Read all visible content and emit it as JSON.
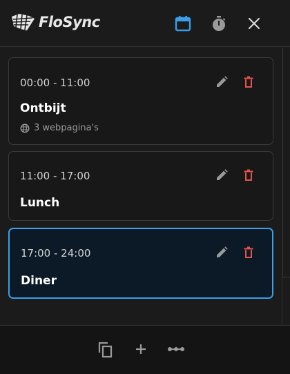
{
  "app": {
    "name": "FloSync",
    "colors": {
      "accent": "#3a9ee8",
      "danger": "#e5534b",
      "icon_muted": "#9a9a9a"
    }
  },
  "header": {
    "logo_icon": "flosync-logo-icon",
    "buttons": [
      {
        "icon": "calendar-icon",
        "active": true
      },
      {
        "icon": "stopwatch-icon",
        "active": false
      },
      {
        "icon": "close-icon",
        "active": false
      }
    ]
  },
  "schedule": {
    "items": [
      {
        "time": "00:00 - 11:00",
        "title": "Ontbijt",
        "meta": "3 webpagina's",
        "meta_icon": "globe-icon",
        "active": false
      },
      {
        "time": "11:00 - 17:00",
        "title": "Lunch",
        "active": false
      },
      {
        "time": "17:00 - 24:00",
        "title": "Diner",
        "active": true
      }
    ],
    "item_actions": [
      "pencil-icon",
      "trash-icon"
    ]
  },
  "footer": {
    "buttons": [
      "copy-icon",
      "plus-icon",
      "more-icon"
    ]
  }
}
